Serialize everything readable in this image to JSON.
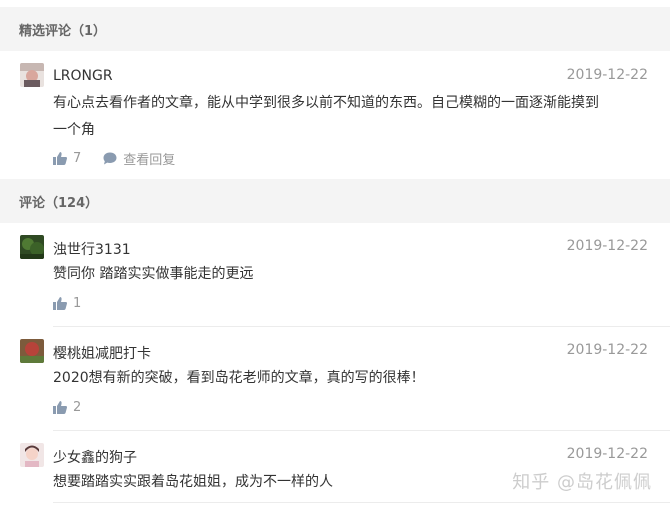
{
  "featured": {
    "header": "精选评论（1）",
    "comments": [
      {
        "username": "LRONGR",
        "date": "2019-12-22",
        "text_line1": "有心点去看作者的文章，能从中学到很多以前不知道的东西。自己模糊的一面逐渐能摸到",
        "text_line2": "一个角",
        "likes": "7",
        "view_replies": "查看回复"
      }
    ]
  },
  "comments": {
    "header": "评论（124）",
    "items": [
      {
        "username": "浊世行3131",
        "date": "2019-12-22",
        "text": "赞同你 踏踏实实做事能走的更远",
        "likes": "1"
      },
      {
        "username": "樱桃姐减肥打卡",
        "date": "2019-12-22",
        "text": "2020想有新的突破，看到岛花老师的文章，真的写的很棒！",
        "likes": "2"
      },
      {
        "username": "少女鑫的狗子",
        "date": "2019-12-22",
        "text": "想要踏踏实实跟着岛花姐姐，成为不一样的人"
      }
    ]
  },
  "watermark": "知乎 @岛花佩佩",
  "colors": {
    "header_bg": "#f4f4f4",
    "icon": "#8a9bb0",
    "muted": "#999999"
  }
}
